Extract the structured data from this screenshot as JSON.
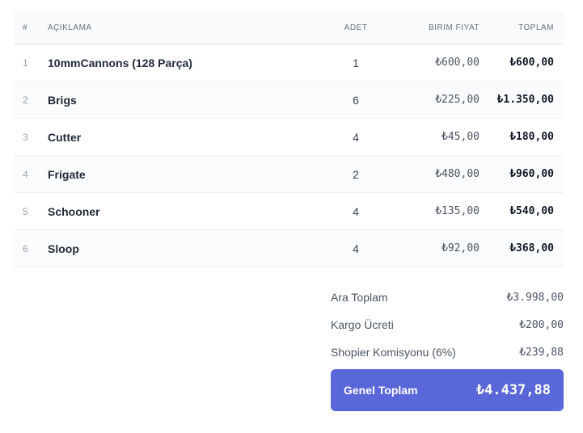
{
  "table": {
    "headers": {
      "num": "#",
      "desc": "AÇIKLAMA",
      "qty": "ADET",
      "unit": "BIRIM FIYAT",
      "total": "TOPLAM"
    },
    "rows": [
      {
        "num": "1",
        "desc": "10mmCannons (128 Parça)",
        "qty": "1",
        "unit": "₺600,00",
        "total": "₺600,00"
      },
      {
        "num": "2",
        "desc": "Brigs",
        "qty": "6",
        "unit": "₺225,00",
        "total": "₺1.350,00"
      },
      {
        "num": "3",
        "desc": "Cutter",
        "qty": "4",
        "unit": "₺45,00",
        "total": "₺180,00"
      },
      {
        "num": "4",
        "desc": "Frigate",
        "qty": "2",
        "unit": "₺480,00",
        "total": "₺960,00"
      },
      {
        "num": "5",
        "desc": "Schooner",
        "qty": "4",
        "unit": "₺135,00",
        "total": "₺540,00"
      },
      {
        "num": "6",
        "desc": "Sloop",
        "qty": "4",
        "unit": "₺92,00",
        "total": "₺368,00"
      }
    ]
  },
  "summary": {
    "subtotal_label": "Ara Toplam",
    "subtotal_value": "₺3.998,00",
    "shipping_label": "Kargo Ücreti",
    "shipping_value": "₺200,00",
    "commission_label": "Shopier Komisyonu (6%)",
    "commission_value": "₺239,88",
    "grand_label": "Genel Toplam",
    "grand_value": "₺4.437,88"
  },
  "colors": {
    "accent": "#5a67d8",
    "header_bg": "#f8fafc"
  }
}
